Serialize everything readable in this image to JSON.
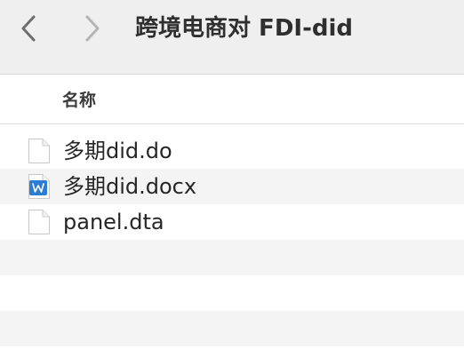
{
  "toolbar": {
    "title": "跨境电商对 FDI-did",
    "back_icon": "chevron-left-icon",
    "forward_icon": "chevron-right-icon"
  },
  "columns": {
    "name_label": "名称"
  },
  "files": [
    {
      "name": "多期did.do",
      "icon": "document-icon"
    },
    {
      "name": "多期did.docx",
      "icon": "word-document-icon"
    },
    {
      "name": "panel.dta",
      "icon": "document-icon"
    }
  ],
  "colors": {
    "toolbar_bg": "#efefef",
    "alt_row_bg": "#f4f4f4",
    "word_icon_blue": "#2b7cd3",
    "chevron_active": "#6e6e6e",
    "chevron_disabled": "#b4b4b4"
  }
}
